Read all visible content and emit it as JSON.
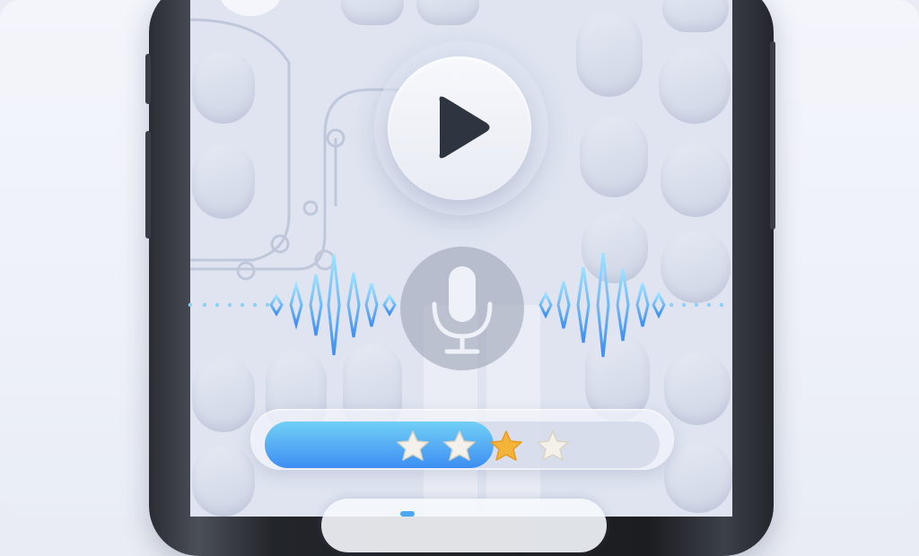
{
  "icons": {
    "play": "play-icon",
    "mic": "microphone-icon",
    "star": "star-icon"
  },
  "player": {
    "play_state": "paused"
  },
  "voice": {
    "state": "listening"
  },
  "rating": {
    "fill_fraction": 0.58,
    "selected_stars": 3,
    "max_stars": 4
  },
  "colors": {
    "accent_start": "#72d0f6",
    "accent_end": "#3e8ef2",
    "star_active": "#f4b43a",
    "star_inactive": "#f3f1ea",
    "play_icon": "#2f3441",
    "wave": "#4fb7f4"
  }
}
